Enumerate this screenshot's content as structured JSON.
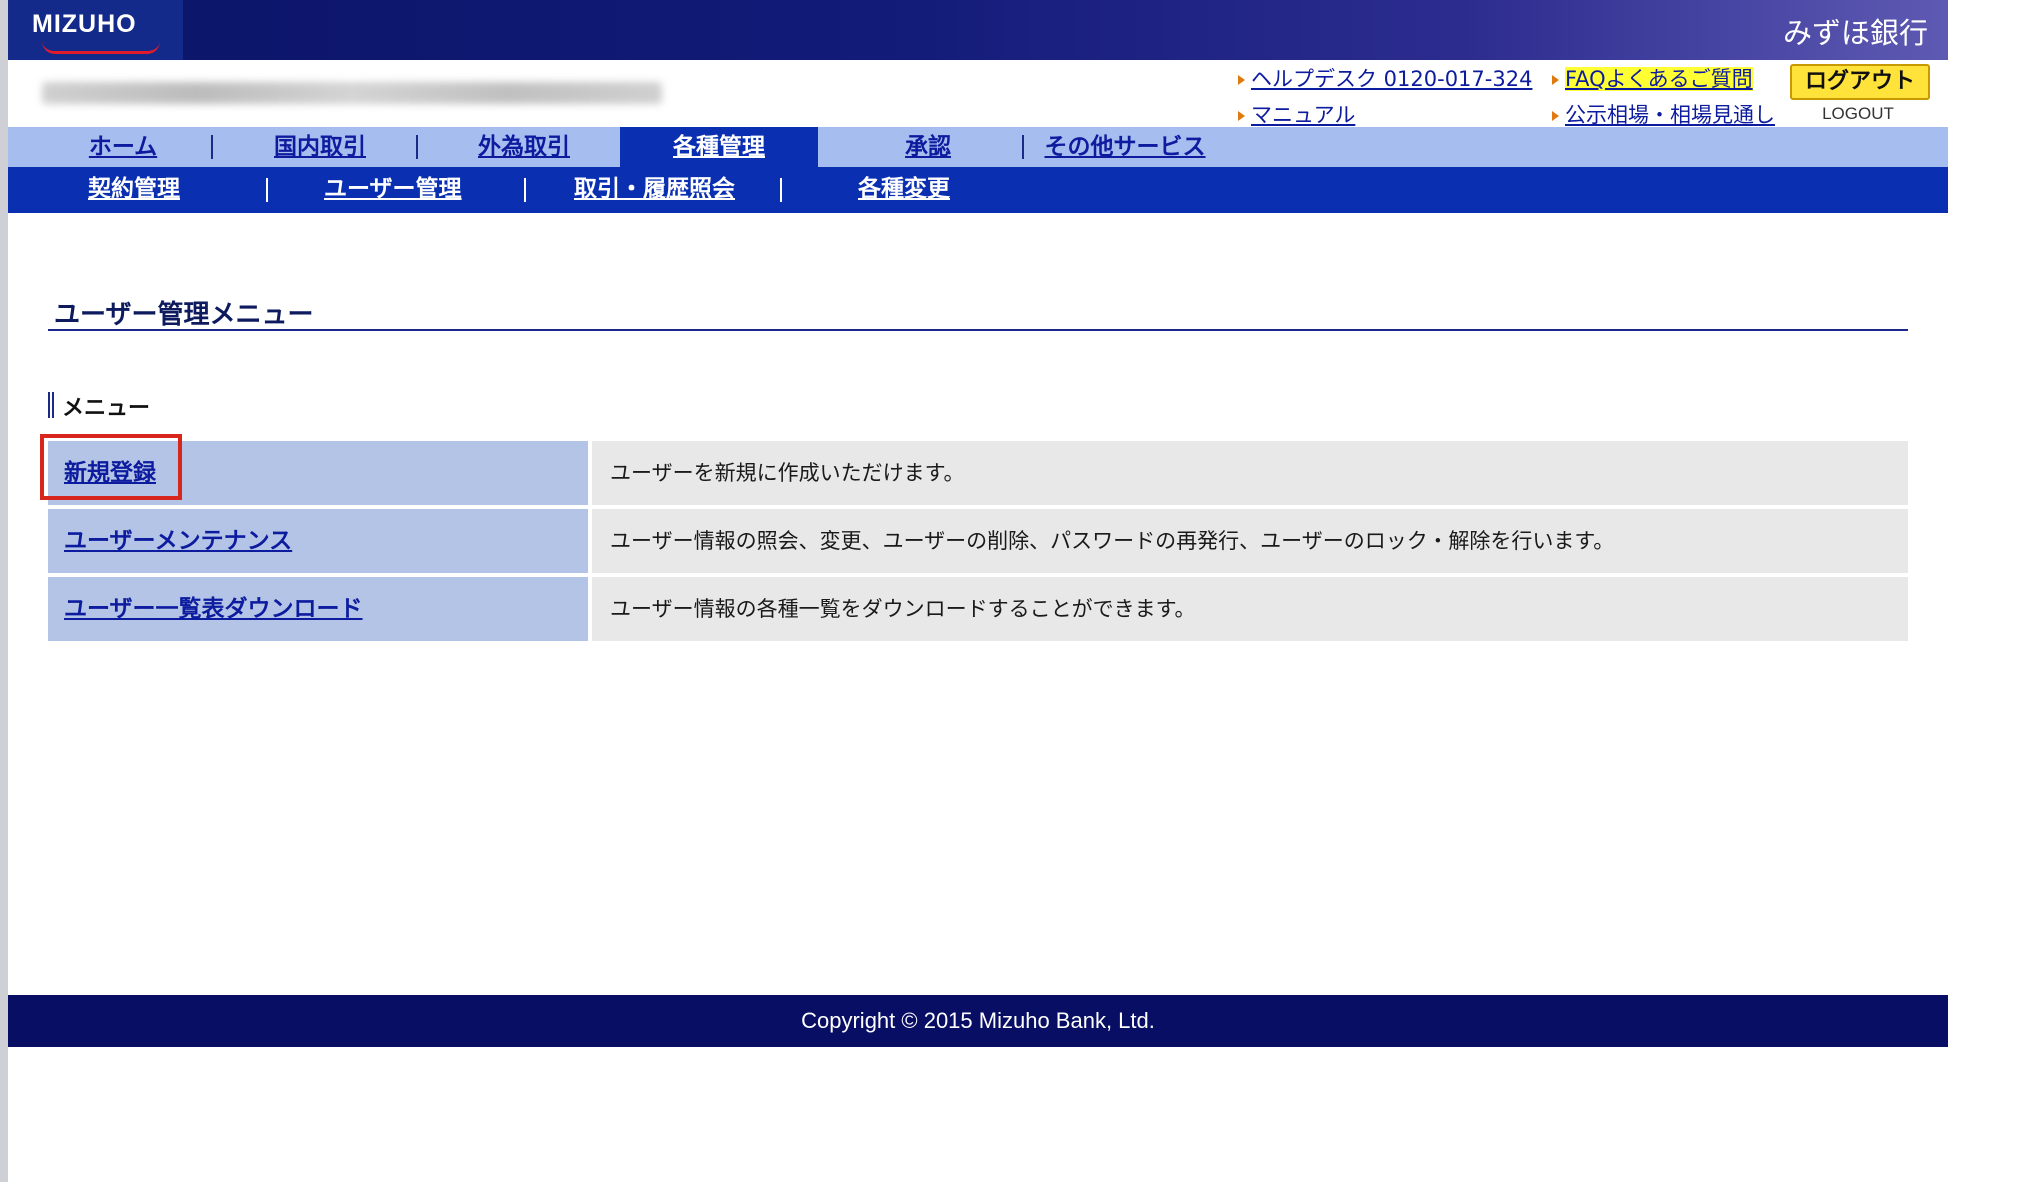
{
  "header": {
    "logo_text": "MIZUHO",
    "bank_name": "みずほ銀行",
    "helpdesk_label": "ヘルプデスク 0120-017-324",
    "faq_label": "FAQよくあるご質問",
    "manual_label": "マニュアル",
    "market_label": "公示相場・相場見通し",
    "logout_label": "ログアウト",
    "logout_sub": "LOGOUT",
    "account_name": ""
  },
  "nav": {
    "main": [
      "ホーム",
      "国内取引",
      "外為取引",
      "各種管理",
      "承認",
      "その他サービス"
    ],
    "active": "各種管理",
    "sub": [
      "契約管理",
      "ユーザー管理",
      "取引・履歴照会",
      "各種変更"
    ]
  },
  "content": {
    "page_title": "ユーザー管理メニュー",
    "section_label": "メニュー",
    "menu": [
      {
        "label": "新規登録",
        "description": "ユーザーを新規に作成いただけます。",
        "highlighted": true
      },
      {
        "label": "ユーザーメンテナンス",
        "description": "ユーザー情報の照会、変更、ユーザーの削除、パスワードの再発行、ユーザーのロック・解除を行います。",
        "highlighted": false
      },
      {
        "label": "ユーザー一覧表ダウンロード",
        "description": "ユーザー情報の各種一覧をダウンロードすることができます。",
        "highlighted": false
      }
    ]
  },
  "footer": {
    "copyright": "Copyright © 2015 Mizuho Bank, Ltd."
  },
  "colors": {
    "header_navy": "#0a1466",
    "nav_light": "#a6bdf0",
    "nav_dark": "#0a2fb0",
    "link": "#0d1b9e",
    "faq_highlight": "#ffff33",
    "logout_button": "#ffe23a",
    "annotation_red": "#d8261c",
    "menu_left_cell": "#b3c4e6",
    "menu_right_cell": "#e8e8e8",
    "footer_navy": "#070e63"
  },
  "icons": {
    "link_bullet": "orange-triangle-arrow-icon"
  }
}
